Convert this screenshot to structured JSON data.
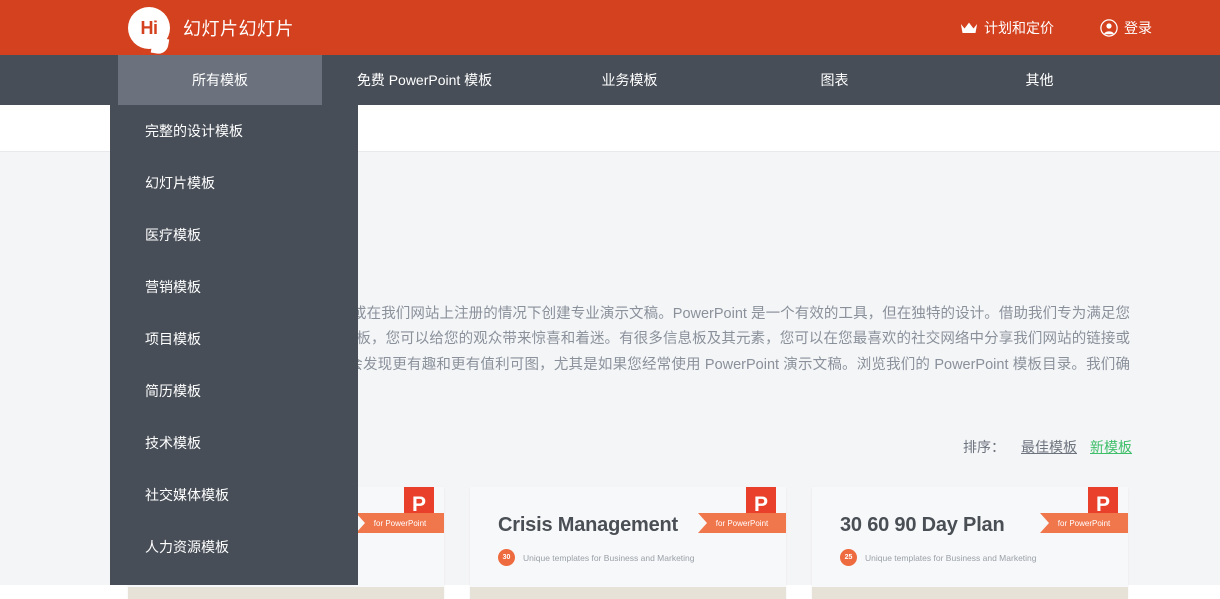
{
  "header": {
    "logo_text": "Hi",
    "logo_icon": "speech-bubble-icon",
    "brand_name": "幻灯片幻灯片",
    "brand_color": "#d4411f",
    "plans_label": "计划和定价",
    "plans_icon": "crown-icon",
    "login_label": "登录",
    "login_icon": "user-circle-icon"
  },
  "nav": {
    "background": "#474e57",
    "active_background": "#6b727d",
    "items": [
      {
        "label": "所有模板",
        "active": true
      },
      {
        "label": "免费 PowerPoint 模板",
        "active": false
      },
      {
        "label": "业务模板",
        "active": false
      },
      {
        "label": "图表",
        "active": false
      },
      {
        "label": "其他",
        "active": false
      }
    ]
  },
  "dropdown": {
    "open_for": "所有模板",
    "items": [
      {
        "label": "完整的设计模板"
      },
      {
        "label": "幻灯片模板"
      },
      {
        "label": "医疗模板"
      },
      {
        "label": "营销模板"
      },
      {
        "label": "项目模板"
      },
      {
        "label": "简历模板"
      },
      {
        "label": "技术模板"
      },
      {
        "label": "社交媒体模板"
      },
      {
        "label": "人力资源模板"
      }
    ]
  },
  "main": {
    "intro_paragraph": "PowerPoint 模板和元素，用于免费或在我们网站上注册的情况下创建专业演示文稿。PowerPoint 是一个有效的工具，但在独特的设计。借助我们专为满足您的任何需求而创建的 PowerPoint 模板，您可以给您的观众带来惊喜和着迷。有很多信息板及其元素，您可以在您最喜欢的社交网络中分享我们网站的链接或订阅后用于演示。付费注册后，您会发现更有趣和更有值利可图，尤其是如果您经常使用 PowerPoint 演示文稿。浏览我们的 PowerPoint 模板目录。我们确定；您会在此处找到许",
    "sort": {
      "label": "排序：",
      "options": [
        {
          "label": "最佳模板",
          "active": false
        },
        {
          "label": "新模板",
          "active": true
        }
      ],
      "active_color": "#3fbf6a"
    },
    "cards": [
      {
        "title": "",
        "badge": "",
        "subtext": "",
        "ppt_letter": "P",
        "ribbon_label": "for PowerPoint"
      },
      {
        "title": "Crisis Management",
        "badge": "30",
        "subtext": "Unique templates for Business and Marketing",
        "ppt_letter": "P",
        "ribbon_label": "for PowerPoint"
      },
      {
        "title": "30 60 90 Day Plan",
        "badge": "25",
        "subtext": "Unique templates for Business and Marketing",
        "ppt_letter": "P",
        "ribbon_label": "for PowerPoint"
      }
    ]
  }
}
